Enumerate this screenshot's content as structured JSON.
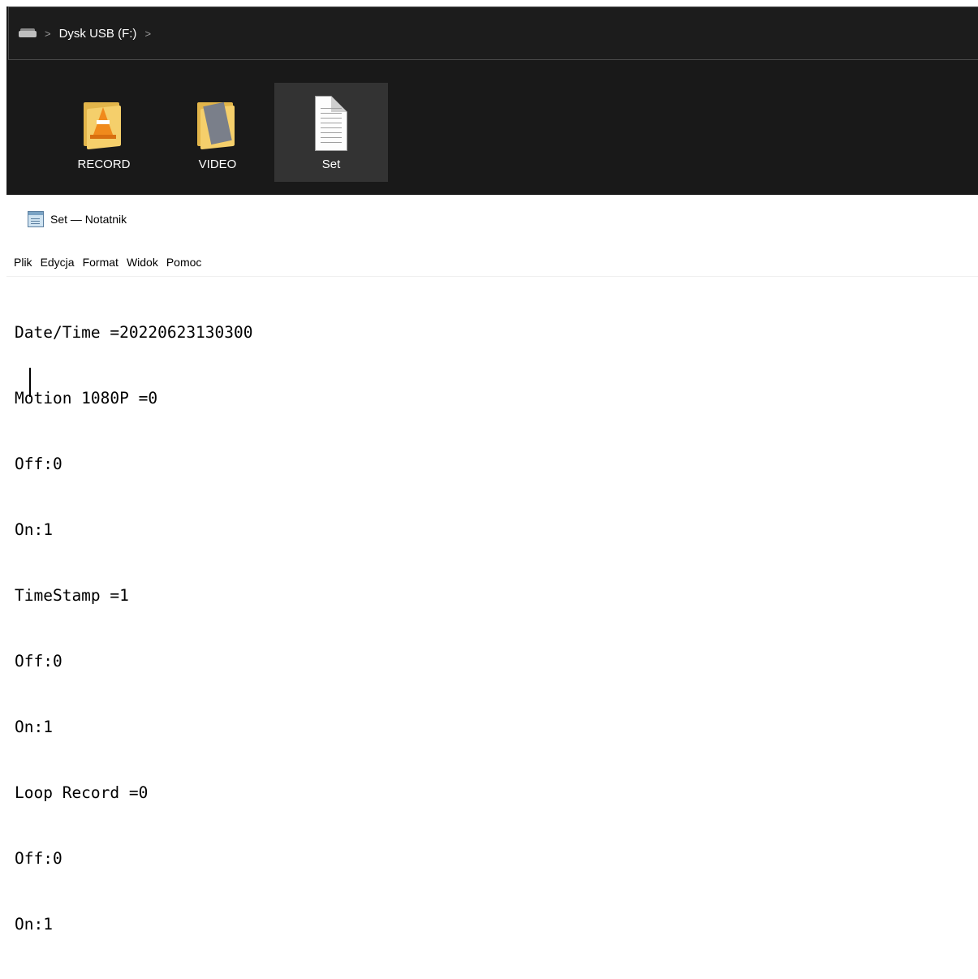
{
  "explorer": {
    "breadcrumb": {
      "drive_label": "Dysk USB (F:)",
      "separator": ">"
    },
    "items": [
      {
        "label": "RECORD",
        "icon": "vlc-folder-icon",
        "selected": false
      },
      {
        "label": "VIDEO",
        "icon": "video-folder-icon",
        "selected": false
      },
      {
        "label": "Set",
        "icon": "text-file-icon",
        "selected": true
      }
    ],
    "colors": {
      "background": "#191919",
      "selected": "#333333",
      "text": "#ffffff"
    }
  },
  "notepad": {
    "title": "Set — Notatnik",
    "menu": [
      "Plik",
      "Edycja",
      "Format",
      "Widok",
      "Pomoc"
    ],
    "lines": [
      "Date/Time =20220623130300",
      "Motion 1080P =0",
      "Off:0",
      "On:1",
      "TimeStamp =1",
      "Off:0",
      "On:1",
      "Loop Record =0",
      "Off:0",
      "On:1"
    ]
  }
}
